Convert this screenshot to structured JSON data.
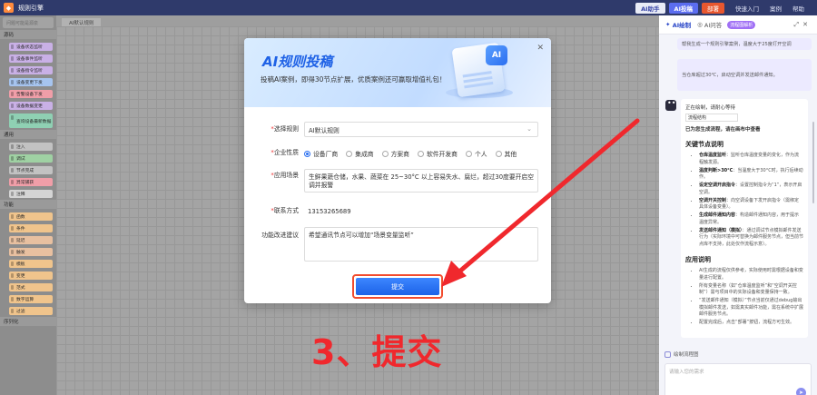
{
  "topbar": {
    "title": "规则引擎",
    "btn_assistant": "AI助手",
    "btn_rules": "AI投稿",
    "btn_deploy": "部署",
    "links": [
      "快速入门",
      "案例",
      "帮助"
    ]
  },
  "palette": {
    "search_placeholder": "问题可能是源泉",
    "groups": [
      {
        "label": "源码",
        "nodes": [
          {
            "label": "设备状态监听",
            "color": "#c9b0e6"
          },
          {
            "label": "设备事件监听",
            "color": "#c9b0e6"
          },
          {
            "label": "设备指令监听",
            "color": "#c9b0e6"
          },
          {
            "label": "设备变更下发",
            "color": "#a6c4ef"
          },
          {
            "label": "告警设备下发",
            "color": "#f09ea8"
          },
          {
            "label": "设备数据变更",
            "color": "#c9b0e6"
          },
          {
            "label": "查询设备最新数据",
            "color": "#8fd0b3",
            "tall": true
          }
        ]
      },
      {
        "label": "通用",
        "nodes": [
          {
            "label": "注入",
            "color": "#c2c2c2"
          },
          {
            "label": "调试",
            "color": "#9fd1a3"
          },
          {
            "label": "节点完成",
            "color": "#c2c2c2"
          },
          {
            "label": "异常捕获",
            "color": "#f09ea8"
          },
          {
            "label": "注释",
            "color": "#d4d4d4"
          }
        ]
      },
      {
        "label": "功能",
        "nodes": [
          {
            "label": "函数",
            "color": "#f0c48c"
          },
          {
            "label": "条件",
            "color": "#f0c48c"
          },
          {
            "label": "延迟",
            "color": "#e8c0a0"
          },
          {
            "label": "触发",
            "color": "#e8c0a0"
          },
          {
            "label": "模板",
            "color": "#f0c48c"
          },
          {
            "label": "变更",
            "color": "#f0c48c"
          },
          {
            "label": "范式",
            "color": "#f0c48c"
          },
          {
            "label": "数字运算",
            "color": "#f0c48c"
          },
          {
            "label": "过滤",
            "color": "#f0c48c"
          }
        ]
      },
      {
        "label": "序列化",
        "nodes": []
      }
    ]
  },
  "canvas": {
    "tab_label": "AI默认规则"
  },
  "modal": {
    "title": "AI规则投稿",
    "subtitle": "投稿AI案例，即得30节点扩展，优质案例还可赢取增值礼包！",
    "deco_badge": "AI",
    "fields": {
      "rule_label": "选择规则",
      "rule_value": "AI默认规则",
      "type_label": "企业性质",
      "type_options": [
        {
          "label": "设备厂商",
          "checked": true
        },
        {
          "label": "集成商",
          "checked": false
        },
        {
          "label": "方案商",
          "checked": false
        },
        {
          "label": "软件开发商",
          "checked": false
        },
        {
          "label": "个人",
          "checked": false
        },
        {
          "label": "其他",
          "checked": false
        }
      ],
      "scene_label": "应用场景",
      "scene_value": "生鲜果蔬仓储，水果、蔬菜在 25~30°C 以上容易失水、腐烂，超过30度要开启空调并报警",
      "contact_label": "联系方式",
      "contact_value": "13153265689",
      "suggest_label": "功能改进建议",
      "suggest_value": "希望通讯节点可以增加“场景变量监听”"
    },
    "submit_label": "提交"
  },
  "annotation": {
    "caption": "3、提交"
  },
  "right_panel": {
    "tab_ai_draw": "AI绘制",
    "tab_ai_qa": "AI问答",
    "tab_badge": "流程图解析",
    "user_msg_1": "帮我生成一个规则引擎案例，温度大于25度打开空调",
    "user_msg_2": "当仓库超过30℃，启动空调并发送邮件通知。",
    "bot": {
      "drawing": "正在绘制，请耐心等待",
      "field_value": "流程结构",
      "done": "已为您生成流程，请在画布中查看",
      "section1": "关键节点说明",
      "items1": [
        {
          "b": "仓库温度监听",
          "t": "：监听仓库温度变量的变化，作为流程触发源。"
        },
        {
          "b": "温度判断>30°C",
          "t": "：当温度大于30°C时，执行后续动作。"
        },
        {
          "b": "设定空调开启指令",
          "t": "：设置控制指令为“1”，表示开启空调。"
        },
        {
          "b": "空调开关控制",
          "t": "：向空调设备下发开启指令（需绑定具体设备变量）。"
        },
        {
          "b": "生成邮件通知内容",
          "t": "：构造邮件通知内容，用于提示温度异常。"
        },
        {
          "b": "发送邮件通知（模拟）",
          "t": "：通过调试节点模拟邮件发送行为（实际环境中可替换为邮件服务节点，但当前节点库不支持，此处仅作流程示意）。"
        }
      ],
      "section2": "应用说明",
      "items2": [
        {
          "b": "",
          "t": "AI生成的流程仅供参考，实际使用时需根据设备和变量进行配置。"
        },
        {
          "b": "",
          "t": "所有变量名称（如“仓库温度监听”和“空调开关控制”）需与项目中的实际设备和变量保持一致。"
        },
        {
          "b": "",
          "t": "“发送邮件通知（模拟）”节点当前仅通过debug输出模拟邮件发送，如需真实邮件功能，需在系统中扩展邮件服务节点。"
        },
        {
          "b": "",
          "t": "配置完成后，点击“部署”按钮，流程方可生效。"
        }
      ]
    },
    "draw_flow": "绘制流程图",
    "input_placeholder": "请输入您的需求"
  },
  "colors": {
    "accent": "#2a6ff0",
    "annotation": "#f0282d",
    "topbar": "#2f3a6b"
  }
}
